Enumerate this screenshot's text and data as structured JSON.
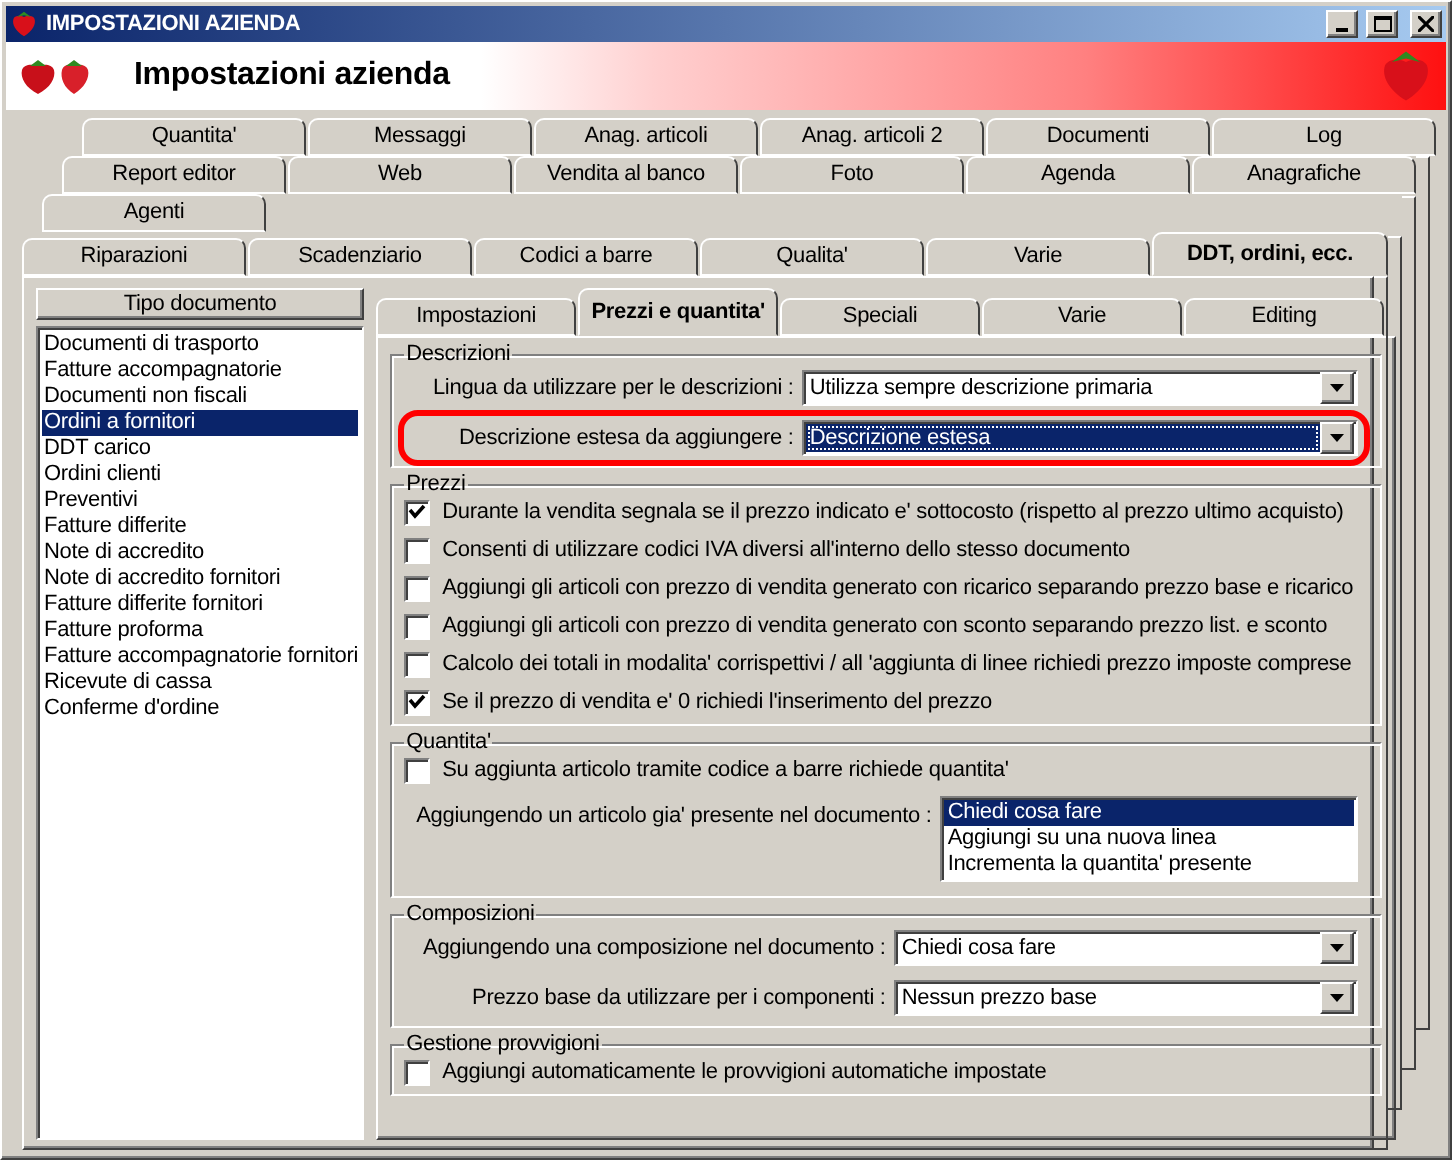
{
  "window": {
    "title": "IMPOSTAZIONI AZIENDA"
  },
  "header": {
    "title": "Impostazioni azienda"
  },
  "tab_rows": [
    [
      {
        "label": "Quantita'",
        "selected": false
      },
      {
        "label": "Messaggi",
        "selected": false
      },
      {
        "label": "Anag. articoli",
        "selected": false
      },
      {
        "label": "Anag. articoli 2",
        "selected": false
      },
      {
        "label": "Documenti",
        "selected": false
      },
      {
        "label": "Log",
        "selected": false
      }
    ],
    [
      {
        "label": "Report editor",
        "selected": false
      },
      {
        "label": "Web",
        "selected": false
      },
      {
        "label": "Vendita al banco",
        "selected": false
      },
      {
        "label": "Foto",
        "selected": false
      },
      {
        "label": "Agenda",
        "selected": false
      },
      {
        "label": "Anagrafiche",
        "selected": false
      }
    ],
    [
      {
        "label": "Agenti",
        "selected": false
      }
    ],
    [
      {
        "label": "Riparazioni",
        "selected": false
      },
      {
        "label": "Scadenziario",
        "selected": false
      },
      {
        "label": "Codici a barre",
        "selected": false
      },
      {
        "label": "Qualita'",
        "selected": false
      },
      {
        "label": "Varie",
        "selected": false
      },
      {
        "label": "DDT, ordini, ecc.",
        "selected": true
      }
    ]
  ],
  "doc_types": {
    "header": "Tipo documento",
    "items": [
      {
        "label": "Documenti di trasporto",
        "selected": false
      },
      {
        "label": "Fatture accompagnatorie",
        "selected": false
      },
      {
        "label": "Documenti non fiscali",
        "selected": false
      },
      {
        "label": "Ordini a fornitori",
        "selected": true
      },
      {
        "label": "DDT carico",
        "selected": false
      },
      {
        "label": "Ordini clienti",
        "selected": false
      },
      {
        "label": "Preventivi",
        "selected": false
      },
      {
        "label": "Fatture differite",
        "selected": false
      },
      {
        "label": "Note di accredito",
        "selected": false
      },
      {
        "label": "Note di accredito fornitori",
        "selected": false
      },
      {
        "label": "Fatture differite fornitori",
        "selected": false
      },
      {
        "label": "Fatture proforma",
        "selected": false
      },
      {
        "label": "Fatture accompagnatorie fornitori",
        "selected": false
      },
      {
        "label": "Ricevute di cassa",
        "selected": false
      },
      {
        "label": "Conferme d'ordine",
        "selected": false
      }
    ]
  },
  "inner_tabs": [
    {
      "label": "Impostazioni",
      "selected": false
    },
    {
      "label": "Prezzi e quantita'",
      "selected": true
    },
    {
      "label": "Speciali",
      "selected": false
    },
    {
      "label": "Varie",
      "selected": false
    },
    {
      "label": "Editing",
      "selected": false
    }
  ],
  "groups": [
    {
      "title": "Descrizioni",
      "rows": [
        {
          "kind": "dropdown",
          "label": "Lingua da utilizzare per le descrizioni :",
          "value": "Utilizza sempre descrizione primaria",
          "focused": false,
          "annotated": false
        },
        {
          "kind": "dropdown",
          "label": "Descrizione estesa da aggiungere :",
          "value": "Descrizione estesa",
          "focused": true,
          "annotated": true
        }
      ]
    },
    {
      "title": "Prezzi",
      "rows": [
        {
          "kind": "checkbox",
          "label": "Durante la vendita segnala se il prezzo indicato e' sottocosto (rispetto al prezzo ultimo acquisto)",
          "checked": true
        },
        {
          "kind": "checkbox",
          "label": "Consenti di utilizzare codici IVA diversi all'interno dello stesso documento",
          "checked": false
        },
        {
          "kind": "checkbox",
          "label": "Aggiungi gli articoli con prezzo di vendita generato con ricarico separando prezzo base e ricarico",
          "checked": false
        },
        {
          "kind": "checkbox",
          "label": "Aggiungi gli articoli con prezzo di vendita generato con sconto separando prezzo list. e sconto",
          "checked": false
        },
        {
          "kind": "checkbox",
          "label": "Calcolo dei totali in modalita' corrispettivi / all 'aggiunta di linee richiedi prezzo imposte comprese",
          "checked": false
        },
        {
          "kind": "checkbox",
          "label": "Se il prezzo di vendita e' 0 richiedi l'inserimento del prezzo",
          "checked": true
        }
      ]
    },
    {
      "title": "Quantita'",
      "rows": [
        {
          "kind": "checkbox",
          "label": "Su aggiunta articolo tramite codice a barre richiede quantita'",
          "checked": false
        },
        {
          "kind": "listbox",
          "label": "Aggiungendo un articolo gia' presente nel documento :",
          "options": [
            {
              "label": "Chiedi cosa fare",
              "selected": true
            },
            {
              "label": "Aggiungi su una nuova linea",
              "selected": false
            },
            {
              "label": "Incrementa la quantita' presente",
              "selected": false
            }
          ]
        }
      ]
    },
    {
      "title": "Composizioni",
      "rows": [
        {
          "kind": "dropdown",
          "label": "Aggiungendo una composizione nel documento :",
          "value": "Chiedi cosa fare",
          "focused": false,
          "annotated": false
        },
        {
          "kind": "dropdown",
          "label": "Prezzo base da utilizzare per i componenti :",
          "value": "Nessun prezzo base",
          "focused": false,
          "annotated": false
        }
      ]
    },
    {
      "title": "Gestione provvigioni",
      "rows": [
        {
          "kind": "checkbox",
          "label": "Aggiungi automaticamente le provvigioni automatiche impostate",
          "checked": false
        }
      ]
    }
  ]
}
